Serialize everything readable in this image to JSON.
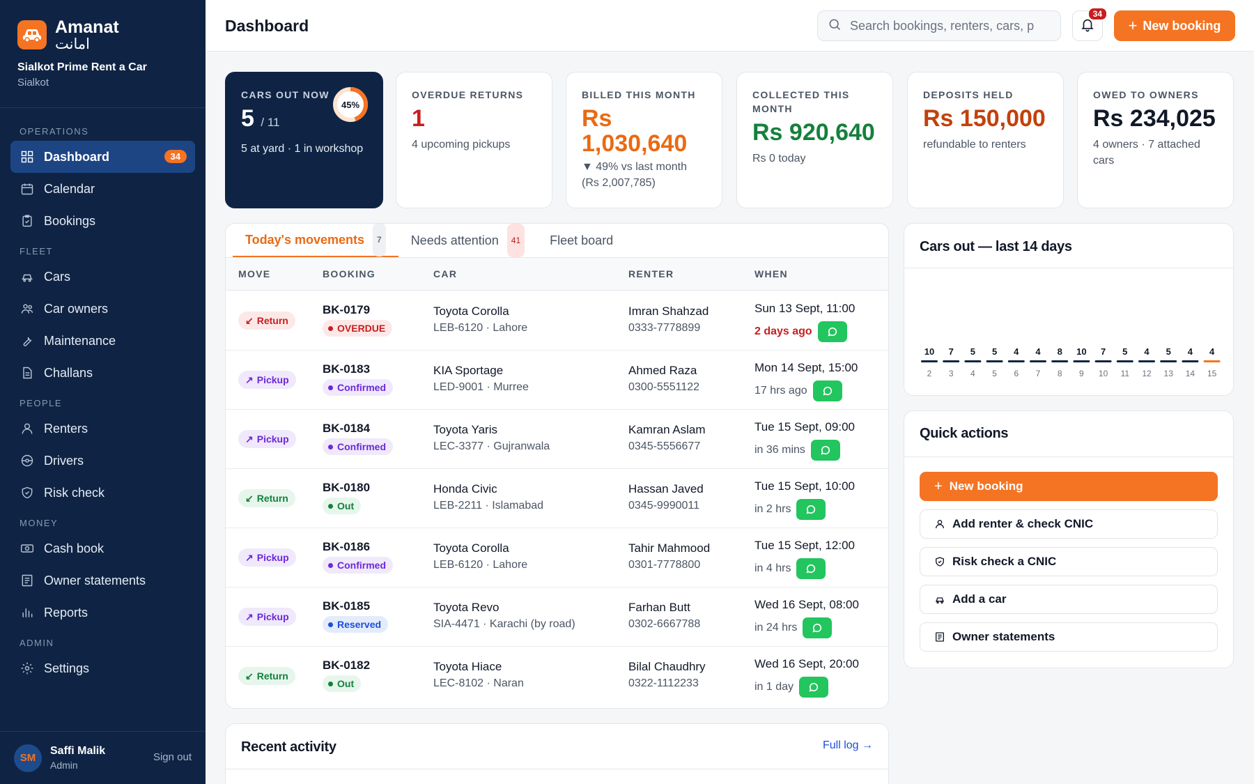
{
  "brand": {
    "name": "Amanat",
    "urdu": "امانت",
    "business": "Sialkot Prime Rent a Car",
    "city": "Sialkot"
  },
  "nav": {
    "sections": [
      {
        "title": "OPERATIONS",
        "items": [
          {
            "label": "Dashboard",
            "icon": "dashboard-icon",
            "badge": "34",
            "active": true
          },
          {
            "label": "Calendar",
            "icon": "calendar-icon"
          },
          {
            "label": "Bookings",
            "icon": "clipboard-icon"
          }
        ]
      },
      {
        "title": "FLEET",
        "items": [
          {
            "label": "Cars",
            "icon": "car-icon"
          },
          {
            "label": "Car owners",
            "icon": "users-icon"
          },
          {
            "label": "Maintenance",
            "icon": "wrench-icon"
          },
          {
            "label": "Challans",
            "icon": "document-icon"
          }
        ]
      },
      {
        "title": "PEOPLE",
        "items": [
          {
            "label": "Renters",
            "icon": "user-icon"
          },
          {
            "label": "Drivers",
            "icon": "steering-wheel-icon"
          },
          {
            "label": "Risk check",
            "icon": "shield-icon"
          }
        ]
      },
      {
        "title": "MONEY",
        "items": [
          {
            "label": "Cash book",
            "icon": "cash-icon"
          },
          {
            "label": "Owner statements",
            "icon": "list-icon"
          },
          {
            "label": "Reports",
            "icon": "bar-chart-icon"
          }
        ]
      },
      {
        "title": "ADMIN",
        "items": [
          {
            "label": "Settings",
            "icon": "gear-icon"
          }
        ]
      }
    ]
  },
  "user": {
    "initials": "SM",
    "name": "Saffi Malik",
    "role": "Admin",
    "sign_out": "Sign out"
  },
  "header": {
    "title": "Dashboard",
    "search_placeholder": "Search bookings, renters, cars, p",
    "notifications": "34",
    "new_booking": "New booking"
  },
  "kpis": {
    "cars_out": {
      "label": "CARS OUT NOW",
      "value": "5",
      "total": "/ 11",
      "sub": "5 at yard · 1 in workshop",
      "percent_label": "45%",
      "percent": 45
    },
    "overdue": {
      "label": "OVERDUE RETURNS",
      "value": "1",
      "sub": "4 upcoming pickups"
    },
    "billed": {
      "label": "BILLED THIS MONTH",
      "value_line1": "Rs",
      "value_line2": "1,030,640",
      "sub1": "▼ 49% vs last month",
      "sub2": "(Rs 2,007,785)"
    },
    "collected": {
      "label_line1": "COLLECTED THIS",
      "label_line2": "MONTH",
      "value": "Rs 920,640",
      "sub": "Rs 0 today"
    },
    "deposits": {
      "label": "DEPOSITS HELD",
      "value": "Rs 150,000",
      "sub": "refundable to renters"
    },
    "owed": {
      "label": "OWED TO OWNERS",
      "value": "Rs 234,025",
      "sub1": "4 owners · 7 attached",
      "sub2": "cars"
    }
  },
  "colors": {
    "accent": "#f47423",
    "navy": "#0f2444",
    "green": "#15803d",
    "red": "#c81e1e",
    "purple": "#6d28d9",
    "blue": "#1d4ed8",
    "whatsapp": "#22c55e"
  },
  "movements": {
    "tabs": [
      {
        "label": "Today's movements",
        "count": "7",
        "active": true
      },
      {
        "label": "Needs attention",
        "count": "41"
      },
      {
        "label": "Fleet board",
        "count": ""
      }
    ],
    "columns": [
      "MOVE",
      "BOOKING",
      "CAR",
      "RENTER",
      "WHEN"
    ],
    "rows": [
      {
        "move": "Return",
        "move_type": "return-red",
        "booking": "BK-0179",
        "status": "OVERDUE",
        "status_type": "overdue",
        "car": "Toyota Corolla",
        "car_sub": "LEB-6120 · Lahore",
        "renter": "Imran Shahzad",
        "phone": "0333-7778899",
        "when": "Sun 13 Sept, 11:00",
        "rel": "2 days ago",
        "rel_red": true
      },
      {
        "move": "Pickup",
        "move_type": "pickup",
        "booking": "BK-0183",
        "status": "Confirmed",
        "status_type": "confirmed",
        "car": "KIA Sportage",
        "car_sub": "LED-9001 · Murree",
        "renter": "Ahmed Raza",
        "phone": "0300-5551122",
        "when": "Mon 14 Sept, 15:00",
        "rel": "17 hrs ago"
      },
      {
        "move": "Pickup",
        "move_type": "pickup",
        "booking": "BK-0184",
        "status": "Confirmed",
        "status_type": "confirmed",
        "car": "Toyota Yaris",
        "car_sub": "LEC-3377 · Gujranwala",
        "renter": "Kamran Aslam",
        "phone": "0345-5556677",
        "when": "Tue 15 Sept, 09:00",
        "rel": "in 36 mins"
      },
      {
        "move": "Return",
        "move_type": "return-green",
        "booking": "BK-0180",
        "status": "Out",
        "status_type": "out",
        "car": "Honda Civic",
        "car_sub": "LEB-2211 · Islamabad",
        "renter": "Hassan Javed",
        "phone": "0345-9990011",
        "when": "Tue 15 Sept, 10:00",
        "rel": "in 2 hrs"
      },
      {
        "move": "Pickup",
        "move_type": "pickup",
        "booking": "BK-0186",
        "status": "Confirmed",
        "status_type": "confirmed",
        "car": "Toyota Corolla",
        "car_sub": "LEB-6120 · Lahore",
        "renter": "Tahir Mahmood",
        "phone": "0301-7778800",
        "when": "Tue 15 Sept, 12:00",
        "rel": "in 4 hrs"
      },
      {
        "move": "Pickup",
        "move_type": "pickup",
        "booking": "BK-0185",
        "status": "Reserved",
        "status_type": "reserved",
        "car": "Toyota Revo",
        "car_sub": "SIA-4471 · Karachi (by road)",
        "renter": "Farhan Butt",
        "phone": "0302-6667788",
        "when": "Wed 16 Sept, 08:00",
        "rel": "in 24 hrs"
      },
      {
        "move": "Return",
        "move_type": "return-green",
        "booking": "BK-0182",
        "status": "Out",
        "status_type": "out",
        "car": "Toyota Hiace",
        "car_sub": "LEC-8102 · Naran",
        "renter": "Bilal Chaudhry",
        "phone": "0322-1112233",
        "when": "Wed 16 Sept, 20:00",
        "rel": "in 1 day"
      }
    ]
  },
  "chart_data": {
    "type": "bar",
    "title": "Cars out — last 14 days",
    "categories": [
      "2",
      "3",
      "4",
      "5",
      "6",
      "7",
      "8",
      "9",
      "10",
      "11",
      "12",
      "13",
      "14",
      "15"
    ],
    "values": [
      10,
      7,
      5,
      5,
      4,
      4,
      8,
      10,
      7,
      5,
      4,
      5,
      4,
      4
    ],
    "highlight_last": true
  },
  "quick_actions": {
    "title": "Quick actions",
    "items": [
      {
        "label": "New booking",
        "icon": "plus-icon",
        "primary": true
      },
      {
        "label": "Add renter & check CNIC",
        "icon": "user-icon"
      },
      {
        "label": "Risk check a CNIC",
        "icon": "shield-icon"
      },
      {
        "label": "Add a car",
        "icon": "car-icon"
      },
      {
        "label": "Owner statements",
        "icon": "list-icon"
      }
    ]
  },
  "recent_activity": {
    "title": "Recent activity",
    "link": "Full log →"
  }
}
